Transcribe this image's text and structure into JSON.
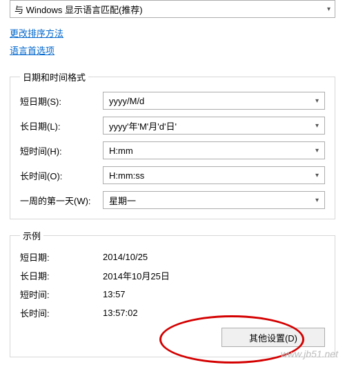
{
  "top_dropdown": {
    "value": "与 Windows 显示语言匹配(推荐)"
  },
  "links": {
    "sort_method": "更改排序方法",
    "language_prefs": "语言首选项"
  },
  "formats": {
    "legend": "日期和时间格式",
    "rows": {
      "short_date": {
        "label": "短日期(S):",
        "value": "yyyy/M/d"
      },
      "long_date": {
        "label": "长日期(L):",
        "value": "yyyy'年'M'月'd'日'"
      },
      "short_time": {
        "label": "短时间(H):",
        "value": "H:mm"
      },
      "long_time": {
        "label": "长时间(O):",
        "value": "H:mm:ss"
      },
      "first_day": {
        "label": "一周的第一天(W):",
        "value": "星期一"
      }
    }
  },
  "examples": {
    "legend": "示例",
    "rows": {
      "short_date": {
        "label": "短日期:",
        "value": "2014/10/25"
      },
      "long_date": {
        "label": "长日期:",
        "value": "2014年10月25日"
      },
      "short_time": {
        "label": "短时间:",
        "value": "13:57"
      },
      "long_time": {
        "label": "长时间:",
        "value": "13:57:02"
      }
    }
  },
  "buttons": {
    "additional_settings": "其他设置(D)"
  },
  "icons": {
    "chevron_down": "▾"
  },
  "watermark": "www.jb51.net"
}
